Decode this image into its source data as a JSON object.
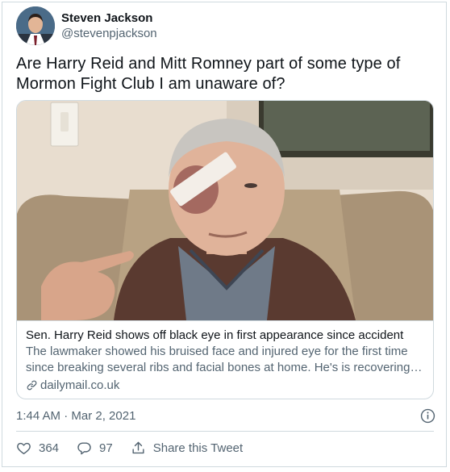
{
  "user": {
    "display_name": "Steven Jackson",
    "handle": "@stevenpjackson"
  },
  "tweet": {
    "text": "Are Harry Reid and Mitt Romney part of some type of Mormon Fight Club I am unaware of?",
    "timestamp": "1:44 AM · Mar 2, 2021"
  },
  "card": {
    "title": "Sen. Harry Reid shows off black eye in first appearance since accident",
    "description": "The lawmaker showed his bruised face and injured eye for the first time since breaking several ribs and facial bones at home. He's is recovering from his injuries.",
    "domain": "dailymail.co.uk"
  },
  "actions": {
    "likes": "364",
    "replies": "97",
    "share_label": "Share this Tweet"
  },
  "icons": {
    "link": "link-icon",
    "info": "info-icon",
    "like": "heart-icon",
    "reply": "reply-icon",
    "share": "share-icon"
  },
  "colors": {
    "text_primary": "#0f1419",
    "text_secondary": "#536471",
    "border": "#cfd9de"
  }
}
